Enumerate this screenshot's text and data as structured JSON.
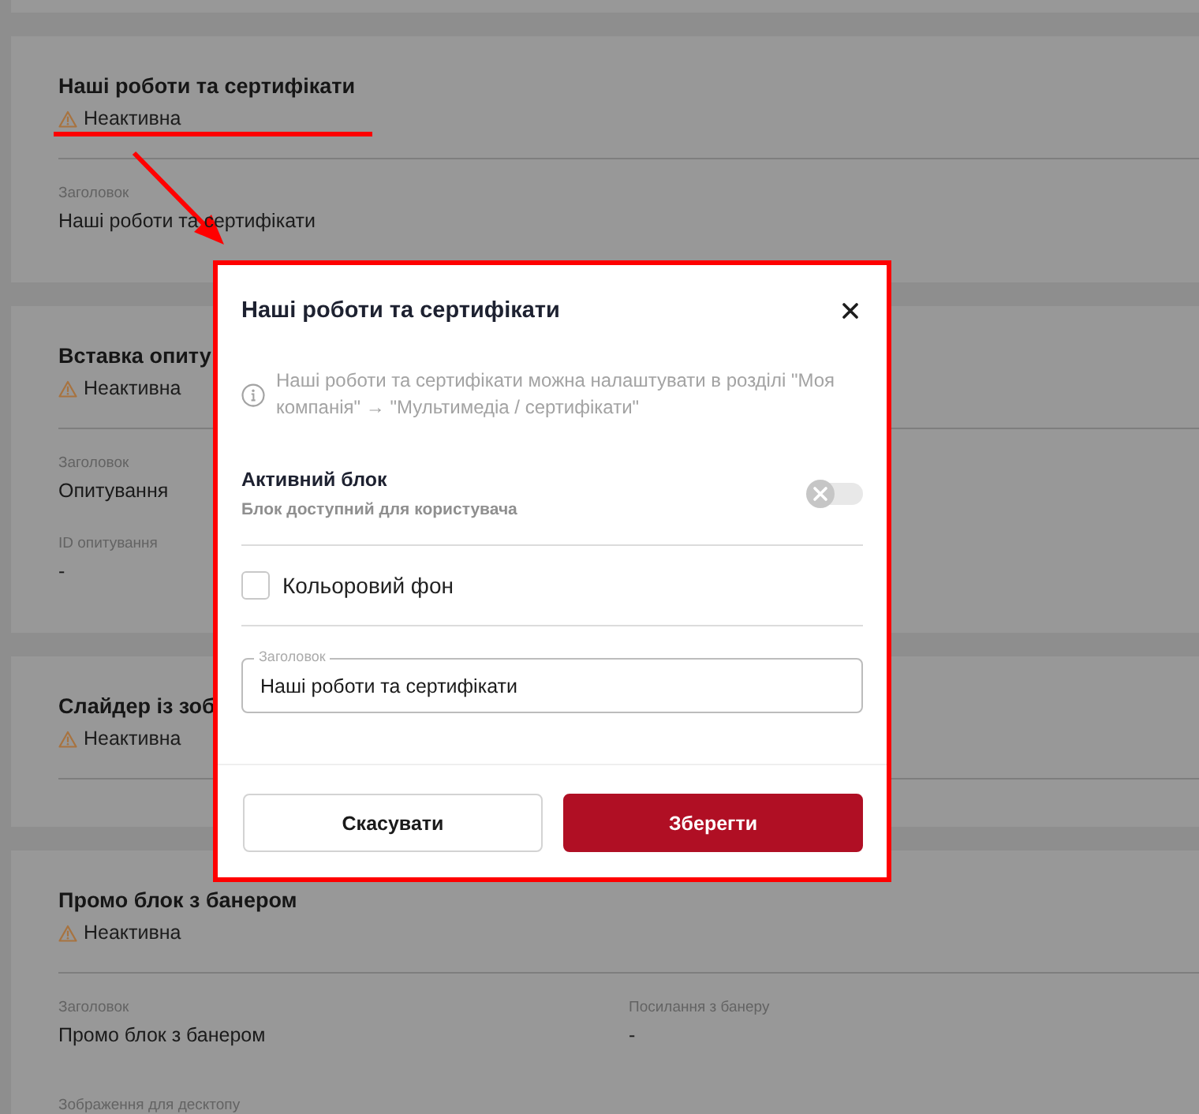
{
  "cards": [
    {
      "title": "Наші роботи та сертифікати",
      "status": "Неактивна",
      "field_rows": [
        [
          {
            "kind": "text",
            "label": "Заголовок",
            "value": "Наші роботи та сертифікати"
          }
        ]
      ]
    },
    {
      "title": "Вставка опиту",
      "status": "Неактивна",
      "field_rows": [
        [
          {
            "kind": "text",
            "label": "Заголовок",
            "value": "Опитування"
          }
        ],
        [
          {
            "kind": "text",
            "label": "ID опитування",
            "value": "-"
          }
        ]
      ]
    },
    {
      "title": "Слайдер із зоб",
      "status": "Неактивна"
    },
    {
      "title": "Промо блок з банером",
      "status": "Неактивна",
      "field_rows": [
        [
          {
            "kind": "text",
            "label": "Заголовок",
            "value": "Промо блок з банером"
          },
          {
            "kind": "text",
            "label": "Посилання з банеру",
            "value": "-"
          }
        ],
        [
          {
            "kind": "image",
            "label": "Зображення для десктопу"
          }
        ]
      ]
    }
  ],
  "dialog": {
    "title": "Наші роботи та сертифікати",
    "info": "Наші роботи та сертифікати можна налаштувати в розділі \"Моя компанія\" → \"Мультимедіа / сертифікати\"",
    "toggle": {
      "label": "Активний блок",
      "description": "Блок доступний для користувача",
      "on": false
    },
    "checkbox": {
      "label": "Кольоровий фон",
      "checked": false
    },
    "field": {
      "label": "Заголовок",
      "value": "Наші роботи та сертифікати"
    },
    "buttons": [
      {
        "kind": "secondary",
        "label": "Скасувати"
      },
      {
        "kind": "primary",
        "label": "Зберегти"
      }
    ]
  }
}
